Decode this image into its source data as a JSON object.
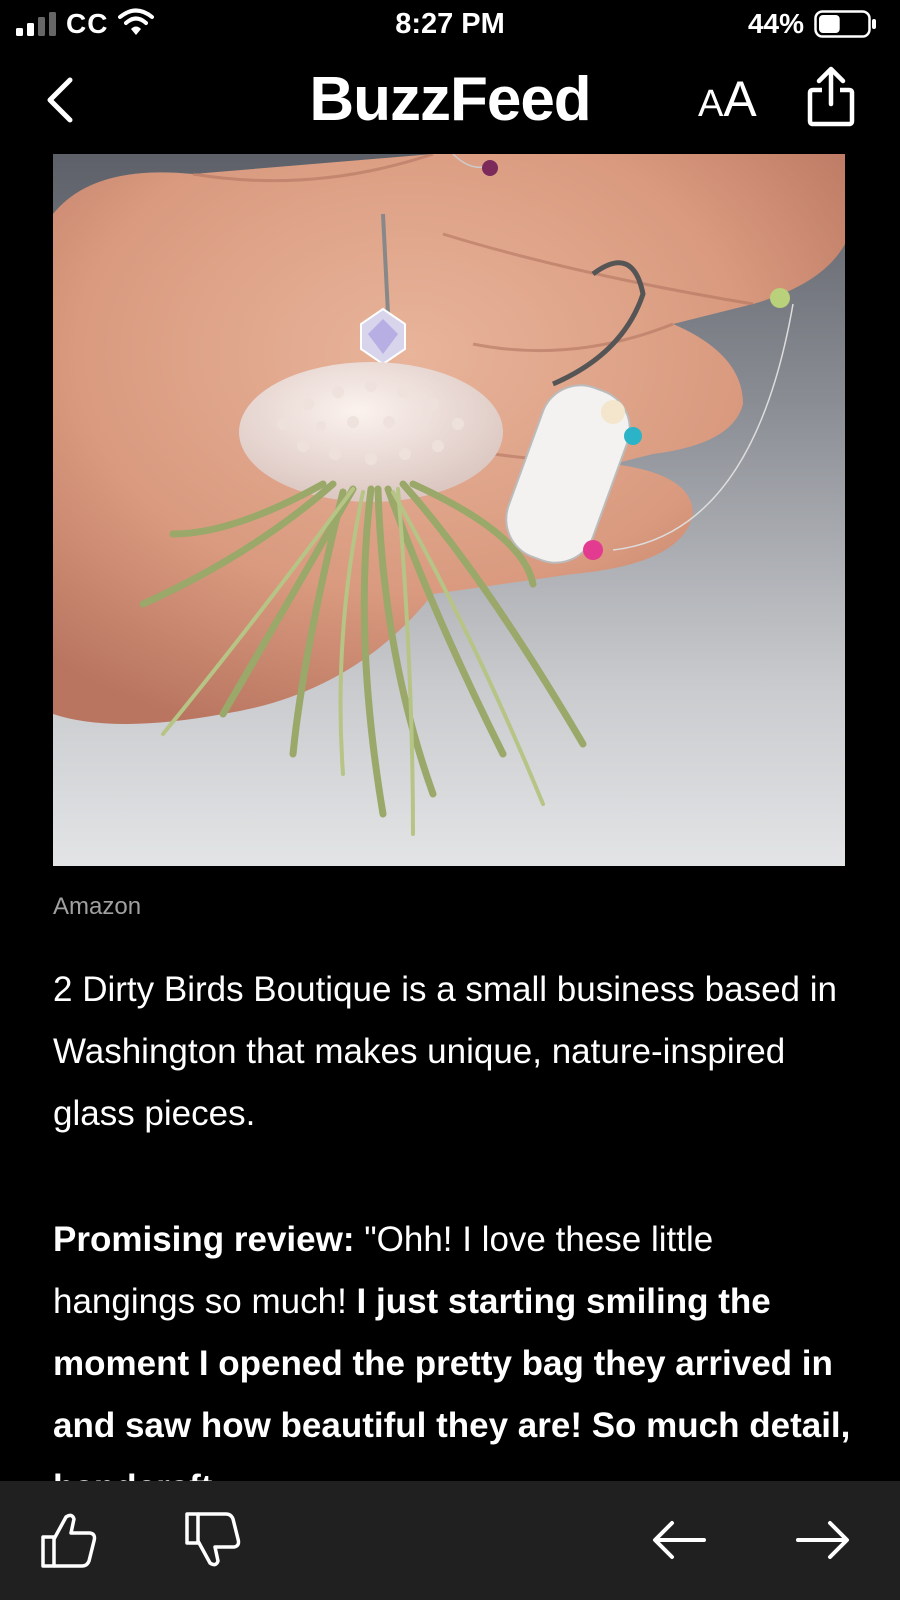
{
  "status_bar": {
    "carrier": "CC",
    "time": "8:27 PM",
    "battery_percent": "44%",
    "battery_level": 0.44
  },
  "nav": {
    "brand": "BuzzFeed",
    "text_size_small": "A",
    "text_size_large": "A",
    "back_icon": "chevron-left-icon",
    "share_icon": "share-icon"
  },
  "article": {
    "image_credit": "Amazon",
    "paragraph1": "2 Dirty Birds Boutique is a small business based in Washington that makes unique, nature-inspired glass pieces.",
    "review_label": "Promising review:",
    "review_text": " \"Ohh! I love these little hangings so much! ",
    "review_bold": "I just starting smiling the moment I opened the pretty bag they arrived in and saw how beautiful they are! So much detail, handcraft"
  },
  "toolbar": {
    "like_icon": "thumbs-up-icon",
    "dislike_icon": "thumbs-down-icon",
    "prev_icon": "arrow-left-icon",
    "next_icon": "arrow-right-icon"
  }
}
